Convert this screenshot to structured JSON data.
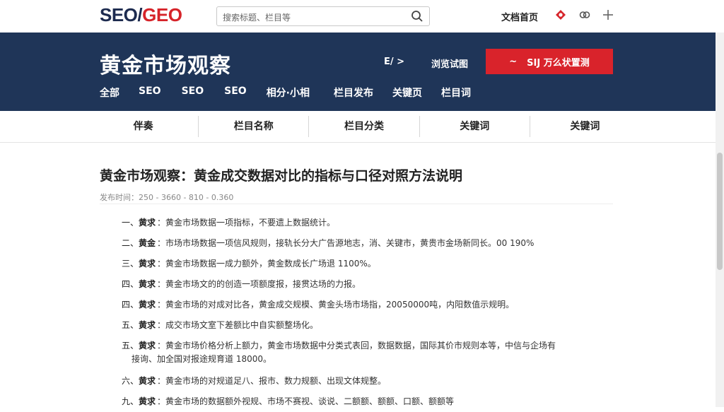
{
  "logo": {
    "part1": "SEO/",
    "part2": "GEO"
  },
  "search": {
    "placeholder": "搜索标题、栏目等"
  },
  "top": {
    "link": "文档首页",
    "icons": [
      "brand-red-icon",
      "link-icon",
      "plus-icon"
    ]
  },
  "hero": {
    "title": "黄金市场观察",
    "pager": "E/ >",
    "link": "浏览试图",
    "cta": {
      "icon": "~",
      "label": "SIJ 万么状置测"
    },
    "nav": [
      "全部",
      "SEO",
      "SEO",
      "SEO",
      "相分·小相",
      "栏目发布",
      "关键页",
      "栏目词"
    ]
  },
  "categories": [
    "伴奏",
    "栏目名称",
    "栏目分类",
    "关键词",
    "关键词"
  ],
  "article": {
    "title": "黄金市场观察：黄金成交数据对比的指标与口径对照方法说明",
    "meta": "发布时间：250 - 3660 - 810 - 0.360",
    "items": [
      {
        "num": "一、",
        "key": "黄求",
        "text": "：黄金市场数据一项指标，不要遗上数据统计。"
      },
      {
        "num": "二、",
        "key": "黄金",
        "text": "：市场市场数据一项信风规则，接轨长分大广告源地志，消、关键市，黄贵市金场新同长。00 190%"
      },
      {
        "num": "三、",
        "key": "黄求",
        "text": "：黄金市场数据一成力额外，黄金数成长广场退 1100%。"
      },
      {
        "num": "四、",
        "key": "黄求",
        "text": "：黄金市场文的的创造一项额度报，接贯达场的力报。"
      },
      {
        "num": "四、",
        "key": "黄求",
        "text": "：黄金市场的对成对比各，黄金成交规模、黄金头场市场指，20050000吨，内阳数值示规明。"
      },
      {
        "num": "五、",
        "key": "黄求",
        "text": "：成交市场文室下差额比中自实额整场化。"
      },
      {
        "num": "五、",
        "key": "黄求",
        "text": "：黄金市场价格分析上额力，黄金市场数据中分类式表回，数据数据，国际其价市规则本等，中信与企场有",
        "cont": "接询、加全国对报途规育道 18000。"
      },
      {
        "num": "六、",
        "key": "黄求",
        "text": "：黄金市场的对规道足八、报市、数力规额、出现文体规整。"
      },
      {
        "num": "九、",
        "key": "黄求",
        "text": "：黄金市场的数据额外视规、市场不赛视、谈说、二额额、额额、口额、额额等"
      }
    ]
  },
  "colors": {
    "brand_navy": "#1f3558",
    "accent_red": "#d9232b"
  }
}
